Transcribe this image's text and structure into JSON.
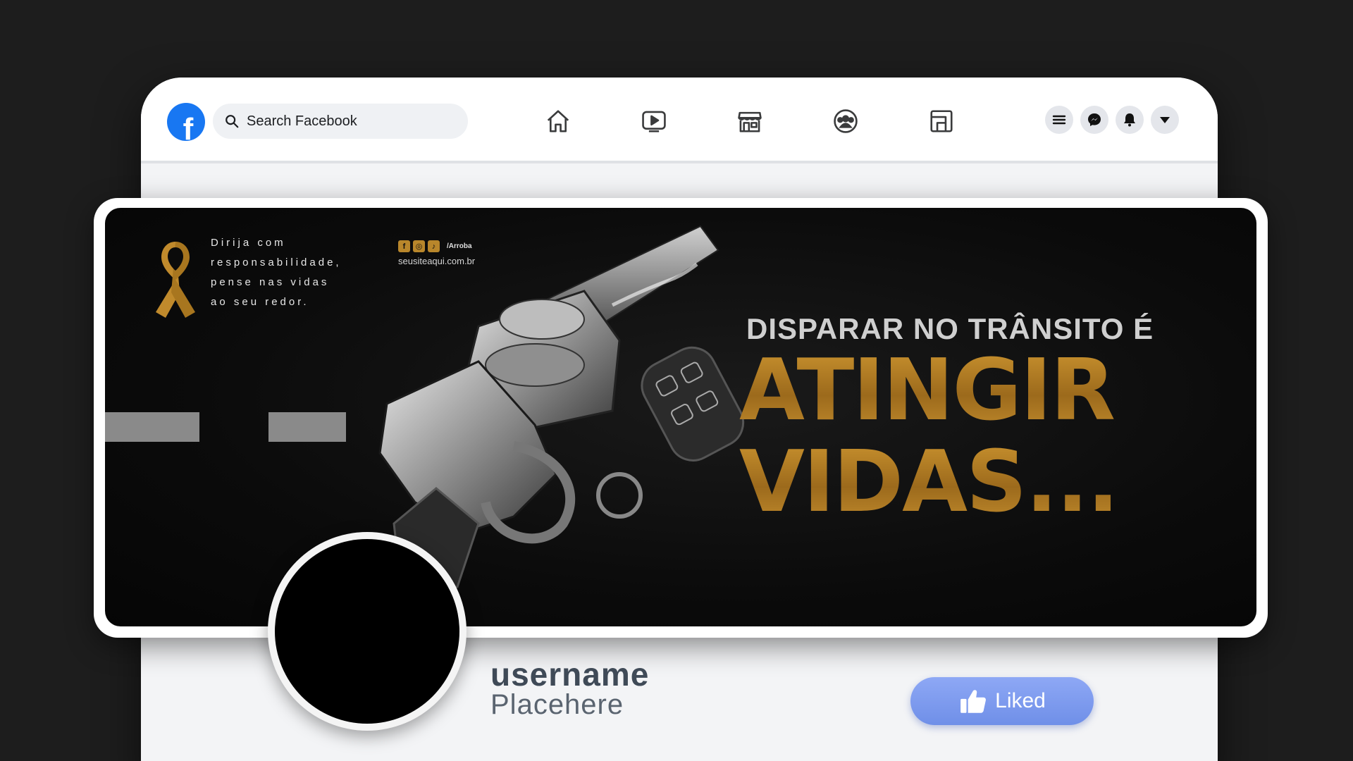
{
  "search": {
    "placeholder": "Search Facebook"
  },
  "nav": {
    "icons": [
      "home-icon",
      "watch-icon",
      "marketplace-icon",
      "groups-icon",
      "gaming-icon"
    ]
  },
  "right_icons": [
    "menu-icon",
    "messenger-icon",
    "notifications-icon",
    "account-dropdown-icon"
  ],
  "cover": {
    "tagline": "Dirija com\nresponsabilidade,\npense nas vidas\nao seu redor.",
    "handle": "/Arroba",
    "website": "seusiteaqui.com.br",
    "headline_small": "DISPARAR NO TRÂNSITO É",
    "headline_line1": "ATINGIR",
    "headline_line2": "VIDAS...",
    "accent_color": "#b8862b"
  },
  "profile": {
    "username": "username",
    "subtitle": "Placehere",
    "like_button": "Liked"
  }
}
